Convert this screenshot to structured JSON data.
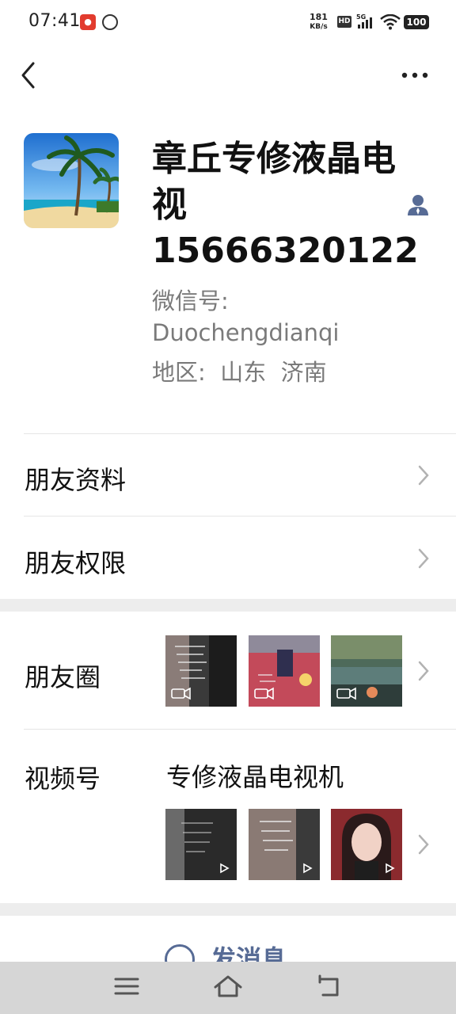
{
  "status_bar": {
    "time": "07:41",
    "speed_value": "181",
    "speed_unit": "KB/s",
    "hd": "HD",
    "network": "5G",
    "battery": "100"
  },
  "header": {
    "back_icon": "chevron-left-icon",
    "more_icon": "more-dots-icon"
  },
  "profile": {
    "name": "章丘专修液晶电视15666320122",
    "wechat_id_label": "微信号:",
    "wechat_id": "Duochengdianqi",
    "region": "地区:  山东  济南",
    "contact_icon": "person-icon",
    "accent": "#576b95"
  },
  "menu": {
    "friend_info": "朋友资料",
    "friend_permissions": "朋友权限",
    "moments": "朋友圈",
    "channels": "视频号",
    "channel_name": "专修液晶电视机"
  },
  "actions": {
    "send_message": "发消息"
  },
  "system_nav": {
    "menu_icon": "menu-icon",
    "home_icon": "home-icon",
    "back_icon": "back-icon"
  }
}
